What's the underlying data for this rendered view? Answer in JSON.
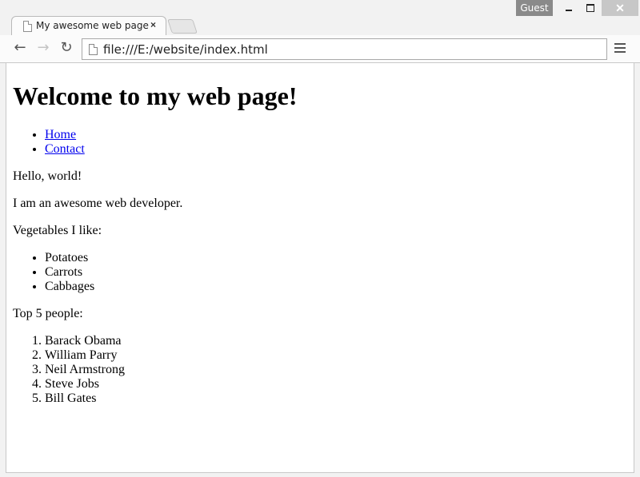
{
  "window": {
    "user_badge": "Guest",
    "minimize_label": "",
    "maximize_label": "",
    "close_label": "✕"
  },
  "tab": {
    "title": "My awesome web page",
    "close_label": "×"
  },
  "toolbar": {
    "back_label": "←",
    "forward_label": "→",
    "reload_label": "↻",
    "url": "file:///E:/website/index.html"
  },
  "page": {
    "heading": "Welcome to my web page!",
    "nav_links": [
      "Home",
      "Contact"
    ],
    "greeting": "Hello, world!",
    "intro": "I am an awesome web developer.",
    "veg_heading": "Vegetables I like:",
    "vegetables": [
      "Potatoes",
      "Carrots",
      "Cabbages"
    ],
    "people_heading": "Top 5 people:",
    "people": [
      "Barack Obama",
      "William Parry",
      "Neil Armstrong",
      "Steve Jobs",
      "Bill Gates"
    ]
  }
}
